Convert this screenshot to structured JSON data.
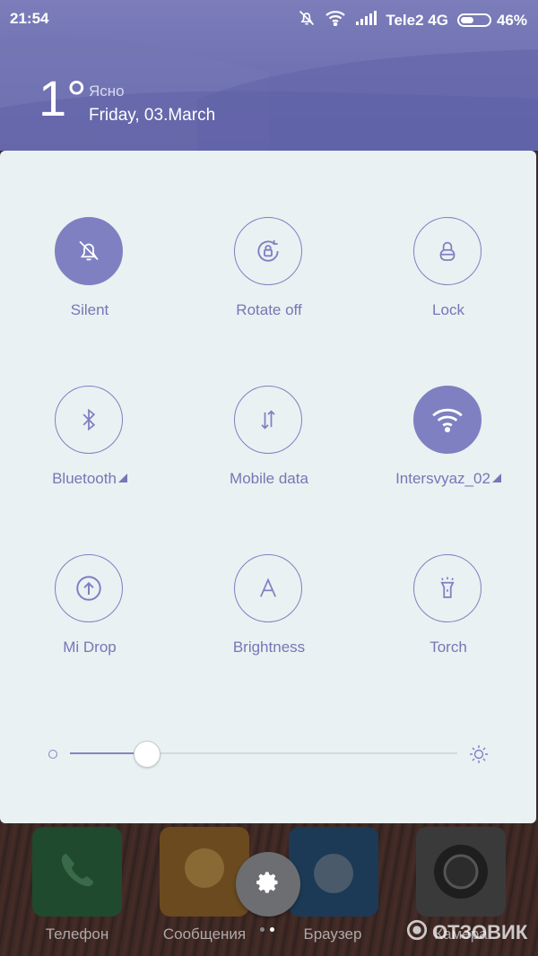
{
  "status_bar": {
    "time": "21:54",
    "carrier": "Tele2 4G",
    "battery_text": "46%",
    "battery_level": 0.46
  },
  "weather": {
    "temperature": "1°",
    "condition": "Ясно",
    "date": "Friday, 03.March"
  },
  "toggles": [
    {
      "label": "Silent",
      "icon": "bell-off-icon",
      "active": true
    },
    {
      "label": "Rotate off",
      "icon": "rotate-lock-icon",
      "active": false
    },
    {
      "label": "Lock",
      "icon": "lock-icon",
      "active": false
    },
    {
      "label": "Bluetooth",
      "icon": "bluetooth-icon",
      "active": false
    },
    {
      "label": "Mobile data",
      "icon": "mobile-data-icon",
      "active": false
    },
    {
      "label": "Intersvyaz_02",
      "icon": "wifi-icon",
      "active": true
    },
    {
      "label": "Mi Drop",
      "icon": "upload-icon",
      "active": false
    },
    {
      "label": "Brightness",
      "icon": "brightness-auto-icon",
      "active": false
    },
    {
      "label": "Torch",
      "icon": "torch-icon",
      "active": false
    }
  ],
  "brightness": {
    "level": 0.2
  },
  "dock": {
    "apps": [
      {
        "label": "Телефон",
        "color": "#1f4a2e"
      },
      {
        "label": "Сообщения",
        "color": "#6a4a1e"
      },
      {
        "label": "Браузер",
        "color": "#1c3a55"
      },
      {
        "label": "Камера",
        "color": "#3a3a3a"
      }
    ]
  },
  "watermark": "ОТЗОВИК",
  "colors": {
    "accent": "#7f80c2",
    "panel": "#eaf1f2",
    "header": "#6c6fb0"
  }
}
